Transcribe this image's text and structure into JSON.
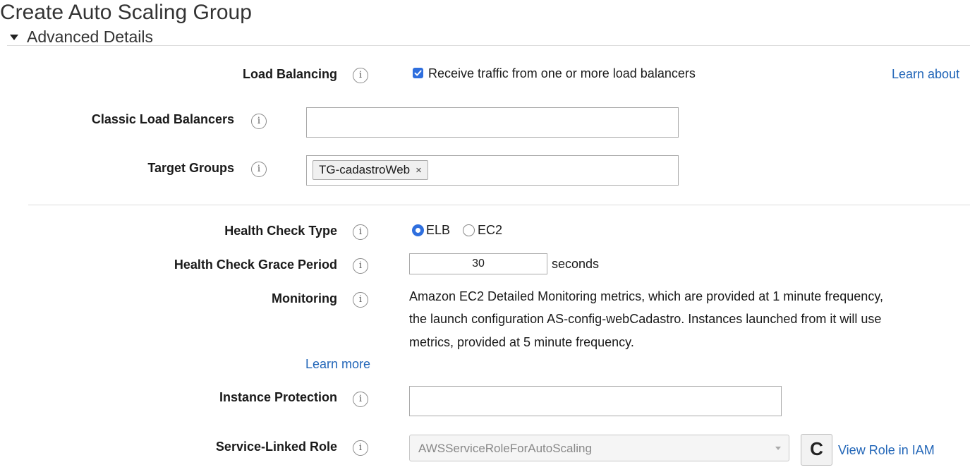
{
  "page": {
    "title": "Create Auto Scaling Group",
    "section_title": "Advanced Details",
    "info_glyph": "i"
  },
  "load_balancing": {
    "label": "Load Balancing",
    "checkbox_checked": true,
    "checkbox_label": "Receive traffic from one or more load balancers",
    "learn_link": "Learn about"
  },
  "classic_load_balancers": {
    "label": "Classic Load Balancers",
    "value": ""
  },
  "target_groups": {
    "label": "Target Groups",
    "tags": [
      "TG-cadastroWeb"
    ],
    "remove_glyph": "×"
  },
  "health_check_type": {
    "label": "Health Check Type",
    "options": [
      "ELB",
      "EC2"
    ],
    "selected": "ELB"
  },
  "health_check_grace": {
    "label": "Health Check Grace Period",
    "value": "30",
    "unit": "seconds"
  },
  "monitoring": {
    "label": "Monitoring",
    "lines": [
      "Amazon EC2 Detailed Monitoring metrics, which are provided at 1 minute frequency,",
      "the launch configuration AS-config-webCadastro. Instances launched from it will use",
      "metrics, provided at 5 minute frequency."
    ],
    "learn_more": "Learn more"
  },
  "instance_protection": {
    "label": "Instance Protection",
    "value": ""
  },
  "service_linked_role": {
    "label": "Service-Linked Role",
    "value": "AWSServiceRoleForAutoScaling",
    "refresh_glyph": "C",
    "view_link": "View Role in IAM"
  },
  "colors": {
    "accent": "#2f6fde",
    "link": "#2266b8",
    "divider": "#dedede"
  }
}
